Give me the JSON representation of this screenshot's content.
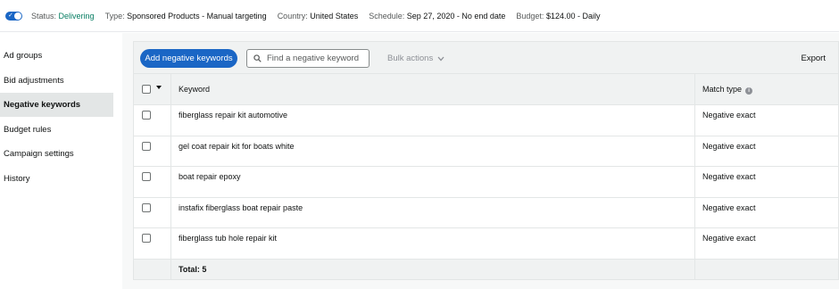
{
  "status_bar": {
    "status_label": "Status:",
    "status_value": "Delivering",
    "type_label": "Type:",
    "type_value": "Sponsored Products - Manual targeting",
    "country_label": "Country:",
    "country_value": "United States",
    "schedule_label": "Schedule:",
    "schedule_value": "Sep 27, 2020 - No end date",
    "budget_label": "Budget:",
    "budget_value": "$124.00 - Daily"
  },
  "sidebar": {
    "items": [
      {
        "label": "Ad groups"
      },
      {
        "label": "Bid adjustments"
      },
      {
        "label": "Negative keywords",
        "active": true
      },
      {
        "label": "Budget rules"
      },
      {
        "label": "Campaign settings"
      },
      {
        "label": "History"
      }
    ]
  },
  "toolbar": {
    "add_label": "Add negative keywords",
    "search_placeholder": "Find a negative keyword",
    "bulk_label": "Bulk actions",
    "export_label": "Export"
  },
  "table": {
    "columns": [
      "Keyword",
      "Match type"
    ],
    "rows": [
      {
        "keyword": "fiberglass repair kit automotive",
        "match_type": "Negative exact"
      },
      {
        "keyword": "gel coat repair kit for boats white",
        "match_type": "Negative exact"
      },
      {
        "keyword": "boat repair epoxy",
        "match_type": "Negative exact"
      },
      {
        "keyword": "instafix fiberglass boat repair paste",
        "match_type": "Negative exact"
      },
      {
        "keyword": "fiberglass tub hole repair kit",
        "match_type": "Negative exact"
      }
    ],
    "total_label": "Total: 5"
  },
  "colors": {
    "accent": "#1a66c5",
    "status_green": "#067d62",
    "sidebar_active": "#e3e6e6"
  },
  "icons": {
    "search": "search-icon",
    "chevron": "chevron-down-icon",
    "info": "info-icon",
    "toggle": "toggle-icon"
  }
}
